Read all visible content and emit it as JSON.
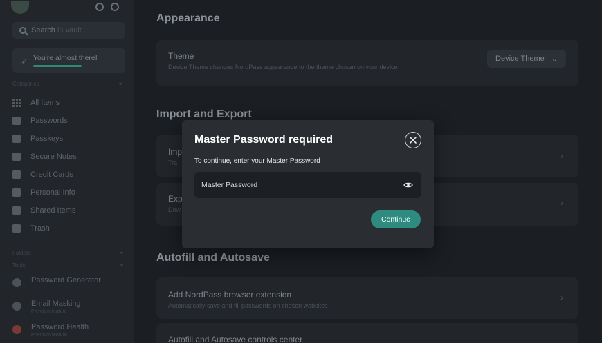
{
  "sidebar": {
    "search": {
      "label": "Search",
      "placeholder": "in vault"
    },
    "promo": {
      "text": "You're almost there!"
    },
    "categories_label": "Categories",
    "items": [
      {
        "label": "All Items",
        "icon": "grid-icon"
      },
      {
        "label": "Passwords",
        "icon": "password-icon"
      },
      {
        "label": "Passkeys",
        "icon": "passkey-icon"
      },
      {
        "label": "Secure Notes",
        "icon": "note-icon"
      },
      {
        "label": "Credit Cards",
        "icon": "card-icon"
      },
      {
        "label": "Personal Info",
        "icon": "person-icon"
      },
      {
        "label": "Shared Items",
        "icon": "shared-icon"
      },
      {
        "label": "Trash",
        "icon": "trash-icon"
      }
    ],
    "folders_label": "Folders",
    "tools_label": "Tools",
    "tools": [
      {
        "label": "Password Generator",
        "sub": ""
      },
      {
        "label": "Email Masking",
        "sub": "Premium feature"
      },
      {
        "label": "Password Health",
        "sub": "Premium feature"
      }
    ]
  },
  "main": {
    "appearance": {
      "heading": "Appearance",
      "theme_title": "Theme",
      "theme_desc": "Device Theme changes NordPass appearance to the theme chosen on your device",
      "theme_value": "Device Theme"
    },
    "import_export": {
      "heading": "Import and Export",
      "import_title": "Imp",
      "import_desc": "Tra",
      "export_title": "Exp",
      "export_desc": "Dow"
    },
    "autofill": {
      "heading": "Autofill and Autosave",
      "ext_title": "Add NordPass browser extension",
      "ext_desc": "Automatically save and fill passwords on chosen websites",
      "controls_title": "Autofill and Autosave controls center"
    }
  },
  "modal": {
    "title": "Master Password required",
    "subtitle": "To continue, enter your Master Password",
    "field_placeholder": "Master Password",
    "continue_label": "Continue"
  },
  "colors": {
    "accent": "#2e8b80",
    "background": "#1b1e22",
    "modal": "#2a2e33"
  }
}
